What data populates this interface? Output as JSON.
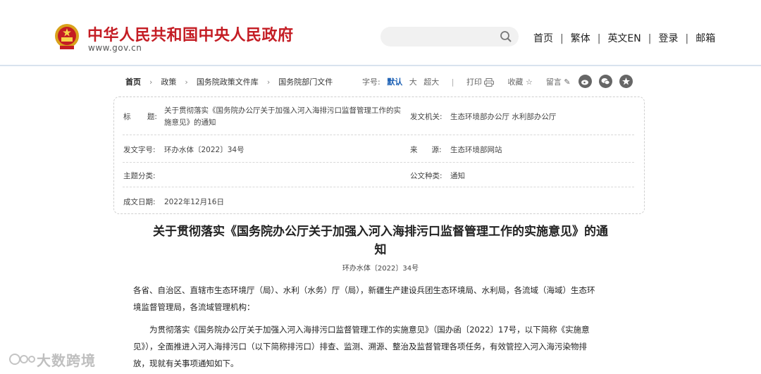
{
  "header": {
    "site_title": "中华人民共和国中央人民政府",
    "site_url": "www.gov.cn",
    "nav": [
      "首页",
      "繁体",
      "英文EN",
      "登录",
      "邮箱"
    ]
  },
  "breadcrumb": [
    "首页",
    "政策",
    "国务院政策文件库",
    "国务院部门文件"
  ],
  "toolbar": {
    "font_size_label": "字号:",
    "font_default": "默认",
    "font_large": "大",
    "font_xlarge": "超大",
    "print": "打印",
    "favorite": "收藏",
    "comment": "留言"
  },
  "info": {
    "title_label": "标       题:",
    "title_value_line1": "关于贯彻落实《国务院办公厅关于加强入河入海排污口监督管理工作的实",
    "title_value_line2": "施意见》的通知",
    "issuer_label": "发文机关:",
    "issuer_value": "生态环境部办公厅  水利部办公厅",
    "doc_no_label": "发文字号:",
    "doc_no_value": "环办水体〔2022〕34号",
    "source_label": "来      源:",
    "source_value": "生态环境部网站",
    "category_label": "主题分类:",
    "category_value": "",
    "doc_type_label": "公文种类:",
    "doc_type_value": "通知",
    "date_label": "成文日期:",
    "date_value": "2022年12月16日"
  },
  "article": {
    "title_line1": "关于贯彻落实《国务院办公厅关于加强入河入海排污口监督管理工作的实施意见》的通",
    "title_line2": "知",
    "doc_no": "环办水体〔2022〕34号",
    "para1_line1": "各省、自治区、直辖市生态环境厅（局）、水利（水务）厅（局），新疆生产建设兵团生态环境局、水利局，各流域（海域）生态环",
    "para1_line2": "境监督管理局，各流域管理机构：",
    "para2_line1": "为贯彻落实《国务院办公厅关于加强入河入海排污口监督管理工作的实施意见》（国办函〔2022〕17号，以下简称《实施意",
    "para2_line2": "见》），全面推进入河入海排污口（以下简称排污口）排查、监测、溯源、整治及监督管理各项任务，有效管控入河入海污染物排",
    "para2_line3": "放，现就有关事项通知如下。"
  },
  "watermark": "大数跨境",
  "colors": {
    "brand_red": "#c41d24",
    "accent_blue": "#1a5fb4"
  }
}
